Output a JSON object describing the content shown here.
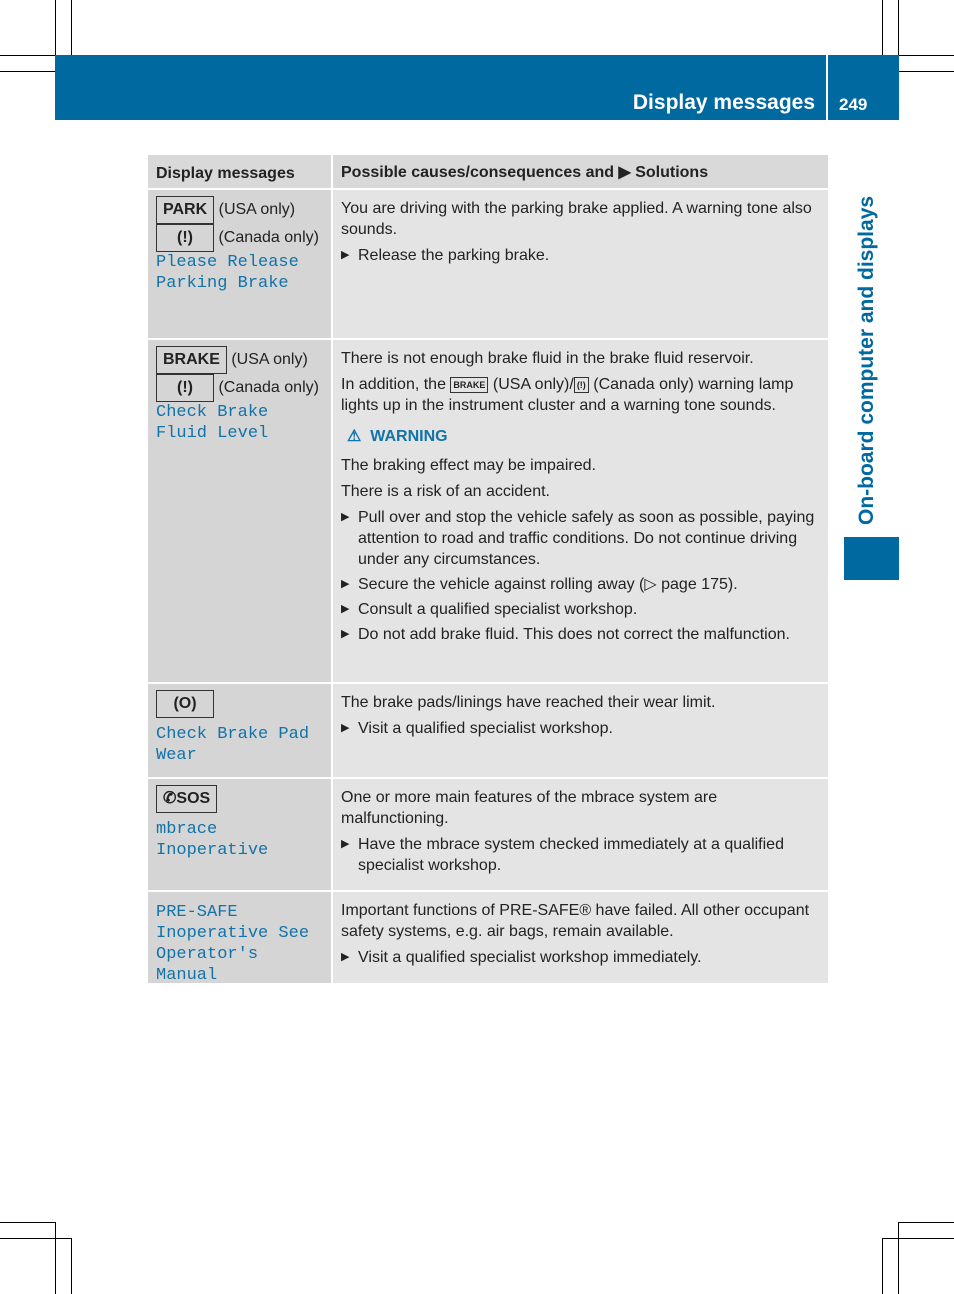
{
  "header": {
    "title": "Display messages",
    "page": "249"
  },
  "side": {
    "chapter": "On-board computer and displays"
  },
  "table": {
    "headers": [
      "Display messages",
      "Possible causes/consequences and ▶ Solutions"
    ],
    "rows": [
      {
        "icon1": "PARK",
        "t1": "(USA only)",
        "icon2": "(!)",
        "t2": "(Canada only)",
        "msg": "Please Release Parking Brake",
        "paras": [
          "You are driving with the parking brake applied. A warning tone also sounds."
        ],
        "bullets": [
          "Release the parking brake."
        ]
      },
      {
        "icon1": "BRAKE",
        "t1": "(USA only)",
        "icon2": "(!)",
        "t2": "(Canada only)",
        "msg": "Check Brake Fluid Level",
        "p1a": "There is not enough brake fluid in the brake fluid reservoir.",
        "p2a": "In addition, the",
        "p2b": "(USA only)/",
        "p2c": "(Canada only) warning lamp lights up in the instrument cluster and a warning tone sounds.",
        "warning": "WARNING",
        "w1": "The braking effect may be impaired.",
        "w2": "There is a risk of an accident.",
        "bullets": [
          "Pull over and stop the vehicle safely as soon as possible, paying attention to road and traffic conditions. Do not continue driving under any circumstances.",
          "Secure the vehicle against rolling away (▷ page 175).",
          "Consult a qualified specialist workshop.",
          "Do not add brake fluid. This does not correct the malfunction."
        ]
      },
      {
        "icon1": "(O)",
        "msg": "Check Brake Pad Wear",
        "paras": [
          "The brake pads/linings have reached their wear limit."
        ],
        "bullets": [
          "Visit a qualified specialist workshop."
        ]
      },
      {
        "icon1": "SOS",
        "msg": "mbrace Inoperative",
        "paras": [
          "One or more main features of the mbrace system are malfunctioning."
        ],
        "bullets": [
          "Have the mbrace system checked immediately at a qualified specialist workshop."
        ]
      },
      {
        "msg": "PRE-SAFE Inoperative See Operator's Manual",
        "paras": [
          "Important functions of PRE-SAFE® have failed. All other occupant safety systems, e.g. air bags, remain available."
        ],
        "bullets": [
          "Visit a qualified specialist workshop immediately."
        ]
      }
    ]
  },
  "colors": {
    "accent": "#0069a0",
    "left_cell": "#d5d5d5",
    "right_cell": "#e4e4e4"
  }
}
